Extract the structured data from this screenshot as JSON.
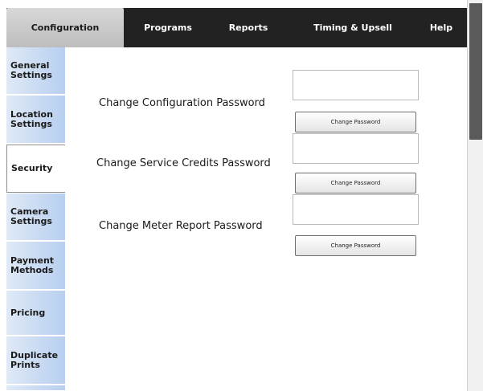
{
  "top_tabs": [
    {
      "label": "Configuration"
    },
    {
      "label": "Programs"
    },
    {
      "label": "Reports"
    },
    {
      "label": "Timing & Upsell"
    },
    {
      "label": "Help"
    }
  ],
  "active_top_tab": "Configuration",
  "sidebar": {
    "items": [
      {
        "label": "General Settings"
      },
      {
        "label": "Location Settings"
      },
      {
        "label": "Security"
      },
      {
        "label": "Camera Settings"
      },
      {
        "label": "Payment Methods"
      },
      {
        "label": "Pricing"
      },
      {
        "label": "Duplicate Prints"
      }
    ],
    "active": "Security"
  },
  "security": {
    "rows": [
      {
        "label": "Change Configuration Password",
        "input_value": "",
        "button_label": "Change Password"
      },
      {
        "label": "Change Service Credits Password",
        "input_value": "",
        "button_label": "Change Password"
      },
      {
        "label": "Change Meter Report Password",
        "input_value": "",
        "button_label": "Change Password"
      }
    ]
  },
  "colors": {
    "topbar": "#222222",
    "sidebar_gradient_start": "#dfe9f6",
    "sidebar_gradient_end": "#b7cff0",
    "active_tab": "#c9c9c9"
  }
}
